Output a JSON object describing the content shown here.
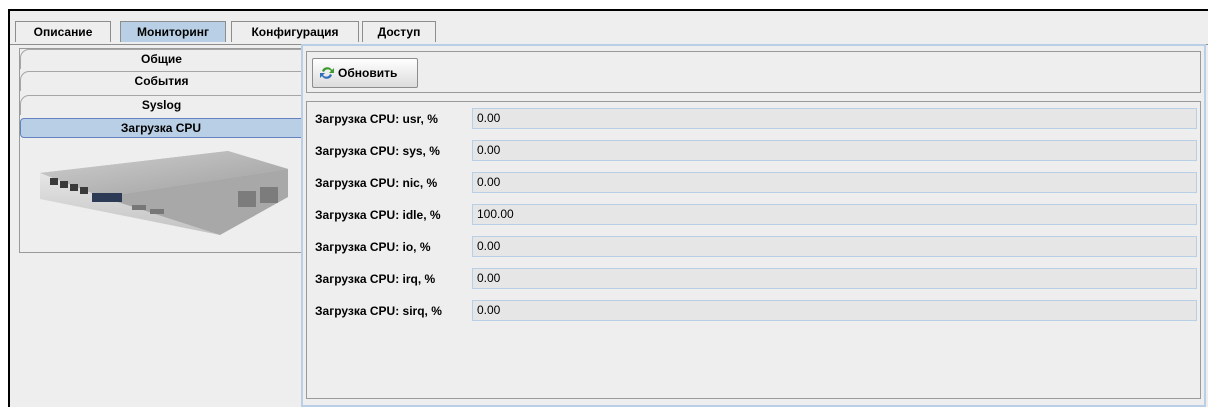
{
  "tabs": [
    "Описание",
    "Мониторинг",
    "Конфигурация",
    "Доступ"
  ],
  "active_tab": "Мониторинг",
  "nav": [
    "Общие",
    "События",
    "Syslog",
    "Загрузка CPU"
  ],
  "selected_nav": "Загрузка CPU",
  "toolbar": {
    "refresh_label": "Обновить"
  },
  "fields": [
    {
      "label": "Загрузка CPU: usr, %",
      "value": "0.00"
    },
    {
      "label": "Загрузка CPU: sys, %",
      "value": "0.00"
    },
    {
      "label": "Загрузка CPU: nic, %",
      "value": "0.00"
    },
    {
      "label": "Загрузка CPU: idle, %",
      "value": "100.00"
    },
    {
      "label": "Загрузка CPU: io, %",
      "value": "0.00"
    },
    {
      "label": "Загрузка CPU: irq, %",
      "value": "0.00"
    },
    {
      "label": "Загрузка CPU: sirq, %",
      "value": "0.00"
    }
  ],
  "colors": {
    "selection": "#b8cfe5",
    "selection_border": "#6382bf",
    "panel": "#eeeeee"
  }
}
